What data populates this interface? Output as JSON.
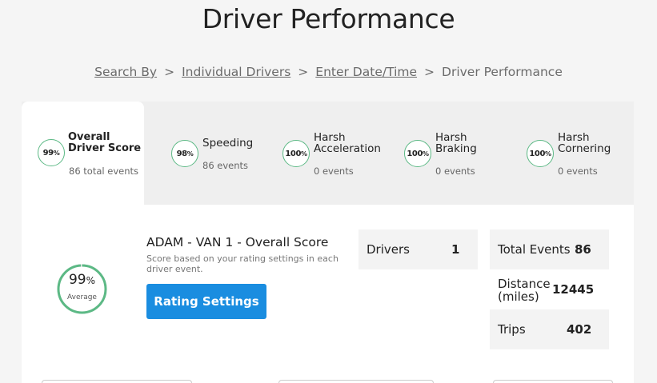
{
  "page_title": "Driver Performance",
  "breadcrumb": {
    "items": [
      "Search By",
      "Individual Drivers",
      "Enter Date/Time"
    ],
    "current": "Driver Performance",
    "separator": ">"
  },
  "tabs": [
    {
      "score": "99",
      "label_line1": "Overall",
      "label_line2": "Driver Score",
      "count": "86 total events"
    },
    {
      "score": "98",
      "label_line1": "Speeding",
      "label_line2": "",
      "count": "86 events"
    },
    {
      "score": "100",
      "label_line1": "Harsh",
      "label_line2": "Acceleration",
      "count": "0 events"
    },
    {
      "score": "100",
      "label_line1": "Harsh",
      "label_line2": "Braking",
      "count": "0 events"
    },
    {
      "score": "100",
      "label_line1": "Harsh",
      "label_line2": "Cornering",
      "count": "0 events"
    }
  ],
  "percent_sign": "%",
  "overall": {
    "score": "99",
    "score_fraction": 0.99,
    "average_label": "Average",
    "title": "ADAM - VAN 1 - Overall Score",
    "description": "Score based on your rating settings in each driver event.",
    "rating_button": "Rating Settings"
  },
  "stats": {
    "drivers_label": "Drivers",
    "drivers_value": "1",
    "total_events_label": "Total Events",
    "total_events_value": "86",
    "distance_label_line1": "Distance",
    "distance_label_line2": "(miles)",
    "distance_value": "12445",
    "trips_label": "Trips",
    "trips_value": "402"
  },
  "colors": {
    "accent_green": "#5cb985",
    "button_blue": "#1a8de0"
  }
}
